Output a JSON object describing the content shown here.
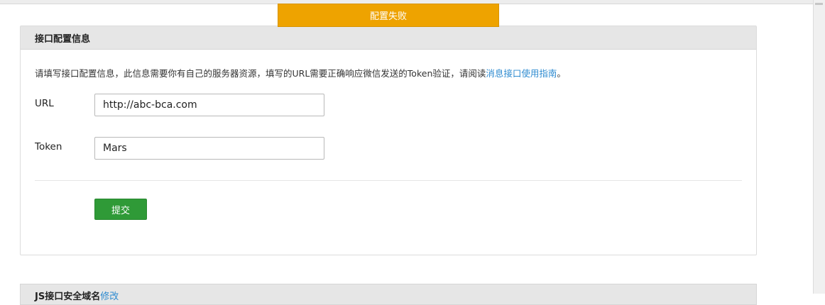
{
  "toast": {
    "message": "配置失败"
  },
  "panel": {
    "title": "接口配置信息",
    "description": "请填写接口配置信息，此信息需要你有自己的服务器资源，填写的URL需要正确响应微信发送的Token验证，请阅读",
    "guide_link": "消息接口使用指南",
    "description_end": "。",
    "url_label": "URL",
    "url_value": "http://abc-bca.com",
    "token_label": "Token",
    "token_value": "Mars",
    "submit_label": "提交"
  },
  "panel2": {
    "title": "JS接口安全域名",
    "link": "修改"
  },
  "colors": {
    "toast_bg": "#eea300",
    "submit_bg": "#2f9a37",
    "link": "#2e8bd0",
    "header_bg": "#e6e6e6"
  }
}
